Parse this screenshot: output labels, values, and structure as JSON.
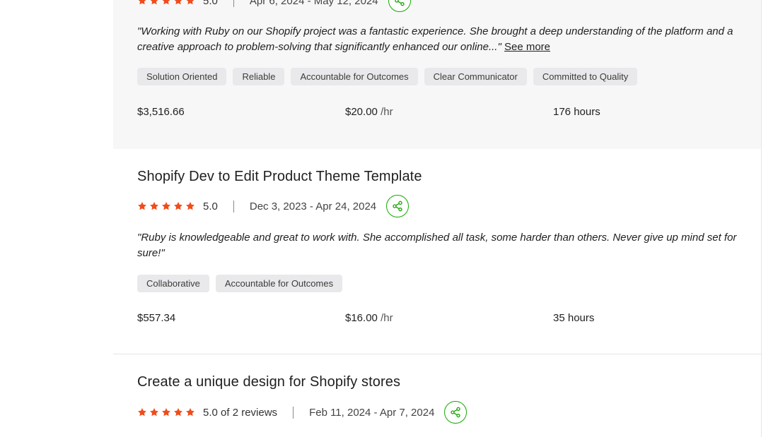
{
  "colors": {
    "star": "#f04d1c",
    "share_accent": "#14a800",
    "tag_bg": "#e9e9ec",
    "highlight_bg": "#f7f7f8"
  },
  "icons": {
    "star": "star-icon",
    "share": "share-icon"
  },
  "jobs": [
    {
      "title": "",
      "rating": "5.0",
      "dates": "Apr 6, 2024 - May 12, 2024",
      "quote": "\"Working with Ruby on our Shopify project was a fantastic experience. She brought a deep understanding of the platform and a creative approach to problem-solving that significantly enhanced our online...\"",
      "see_more": "See more",
      "tags": [
        "Solution Oriented",
        "Reliable",
        "Accountable for Outcomes",
        "Clear Communicator",
        "Committed to Quality"
      ],
      "earned": "$3,516.66",
      "rate": "$20.00",
      "rate_unit": "/hr",
      "hours": "176 hours"
    },
    {
      "title": "Shopify Dev to Edit Product Theme Template",
      "rating": "5.0",
      "dates": "Dec 3, 2023 - Apr 24, 2024",
      "quote": "\"Ruby is knowledgeable and great to work with. She accomplished all task, some harder than others. Never give up mind set for sure!\"",
      "tags": [
        "Collaborative",
        "Accountable for Outcomes"
      ],
      "earned": "$557.34",
      "rate": "$16.00",
      "rate_unit": "/hr",
      "hours": "35 hours"
    },
    {
      "title": "Create a unique design for Shopify stores",
      "rating": "5.0 of 2 reviews",
      "dates": "Feb 11, 2024 - Apr 7, 2024"
    }
  ]
}
